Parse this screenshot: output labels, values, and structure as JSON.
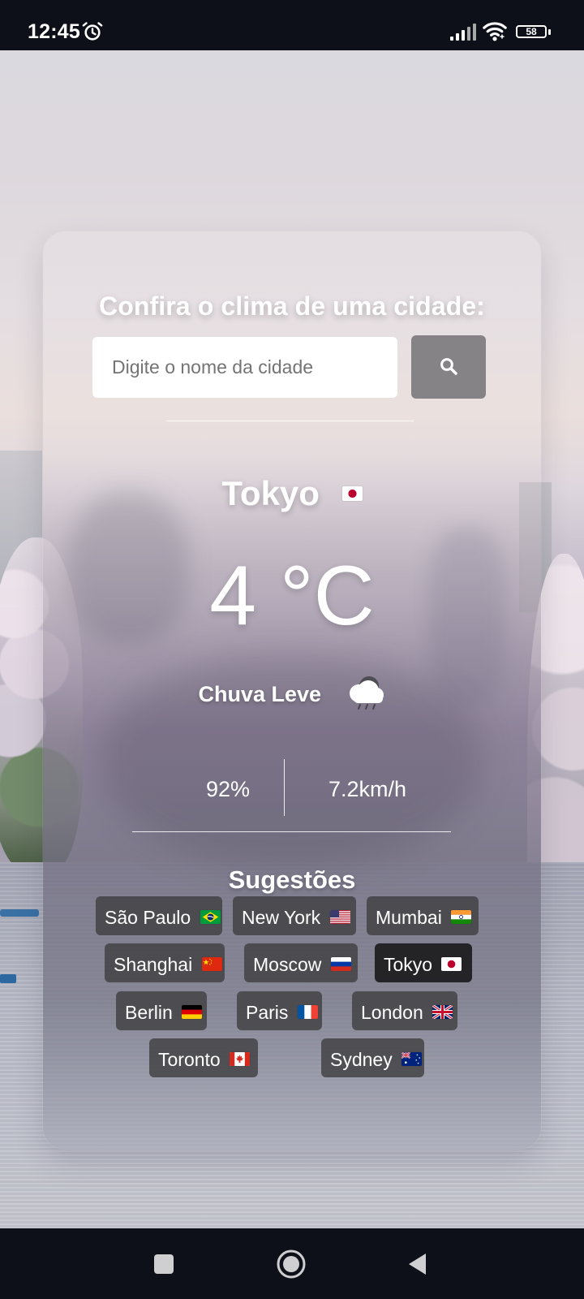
{
  "status_bar": {
    "time": "12:45",
    "battery_level": "58",
    "alarm_icon": "alarm-clock-icon",
    "signal_icon": "cellular-signal-icon",
    "wifi_icon": "wifi-icon",
    "battery_icon": "battery-icon"
  },
  "weather_app": {
    "title": "Confira o clima de uma cidade:",
    "search_placeholder": "Digite o nome da cidade",
    "search_value": "",
    "search_icon": "search-icon",
    "city": "Tokyo",
    "city_flag": "japan-flag-icon",
    "temperature": "4 °C",
    "condition": "Chuva Leve",
    "condition_icon": "light-rain-cloud-icon",
    "humidity": "92%",
    "wind_speed": "7.2km/h",
    "suggestions_title": "Sugestões",
    "suggestions": [
      {
        "label": "São Paulo",
        "flag_icon": "brazil-flag-icon"
      },
      {
        "label": "New York",
        "flag_icon": "united-states-flag-icon"
      },
      {
        "label": "Mumbai",
        "flag_icon": "india-flag-icon"
      },
      {
        "label": "Shanghai",
        "flag_icon": "china-flag-icon"
      },
      {
        "label": "Moscow",
        "flag_icon": "russia-flag-icon"
      },
      {
        "label": "Tokyo",
        "flag_icon": "japan-flag-icon",
        "selected": true
      },
      {
        "label": "Berlin",
        "flag_icon": "germany-flag-icon"
      },
      {
        "label": "Paris",
        "flag_icon": "france-flag-icon"
      },
      {
        "label": "London",
        "flag_icon": "united-kingdom-flag-icon"
      },
      {
        "label": "Toronto",
        "flag_icon": "canada-flag-icon"
      },
      {
        "label": "Sydney",
        "flag_icon": "australia-flag-icon"
      }
    ]
  },
  "navigation_bar": {
    "recent_apps_icon": "square-recent-apps-icon",
    "home_icon": "circle-home-icon",
    "back_icon": "triangle-back-icon"
  },
  "colors": {
    "status_bar": "#0D1018",
    "text_primary": "#FFFFFF",
    "search_button": "#858385",
    "chip_background": "#404042",
    "selected_chip_background": "#1A1A1C"
  }
}
